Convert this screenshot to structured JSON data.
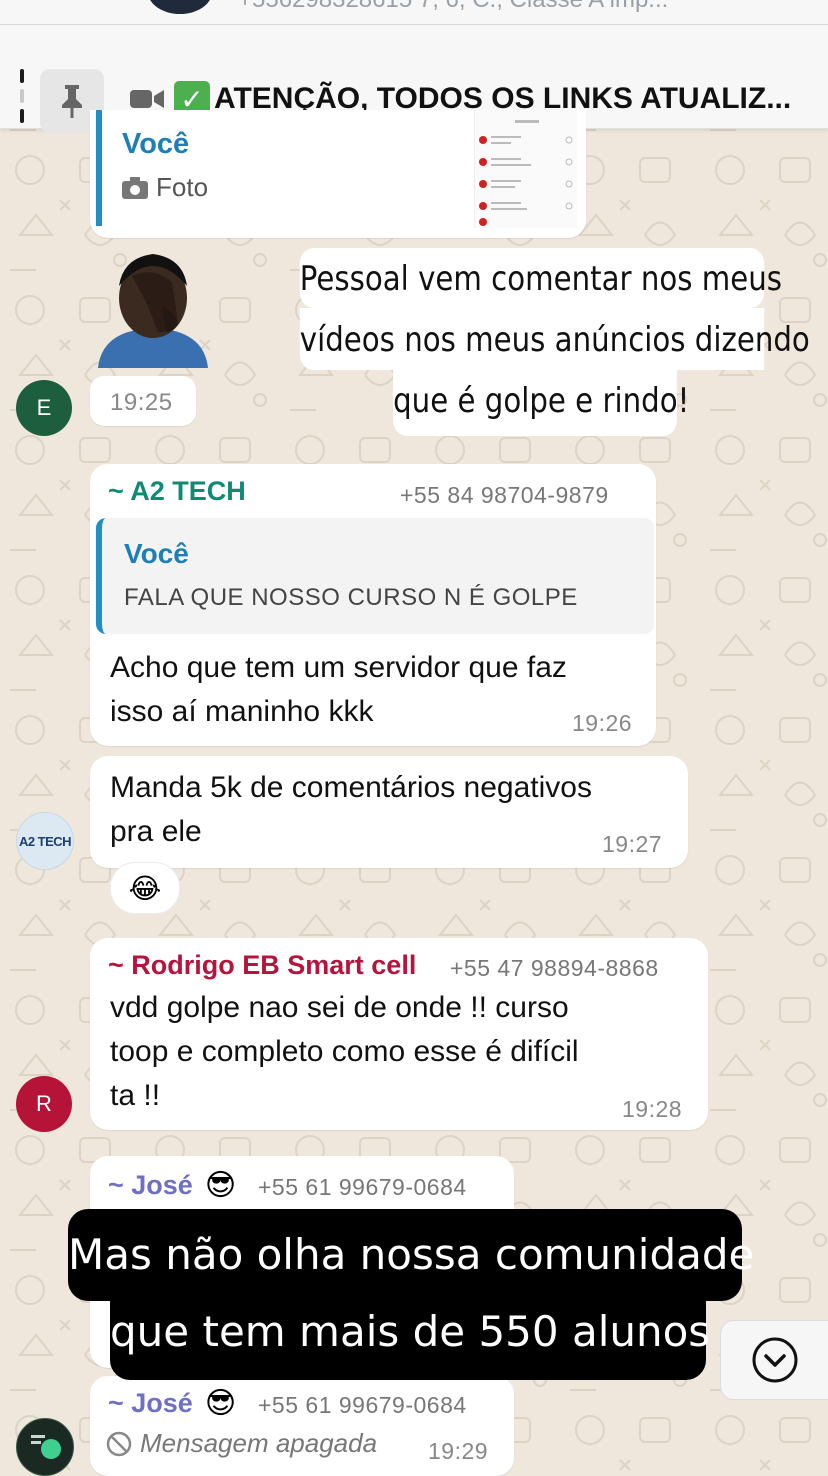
{
  "header": {
    "subtitle": "+556298328615 7, 6, C., Classe A imp..."
  },
  "pinned": {
    "text": "ATENÇÃO, TODOS OS LINKS ATUALIZ...",
    "check_icon": "✅"
  },
  "photo_reply": {
    "author": "Você",
    "label": "Foto"
  },
  "story_overlay_1": {
    "lines": [
      "Pessoal vem comentar nos meus",
      "vídeos nos meus anúncios dizendo",
      "que é golpe e rindo!"
    ]
  },
  "first_time": "19:25",
  "avatars": {
    "e": "E",
    "r": "R",
    "a2tech": "A2 TECH"
  },
  "messages": [
    {
      "sender": "~ A2 TECH",
      "phone": "+55 84 98704-9879",
      "quote_author": "Você",
      "quote_text": "FALA QUE NOSSO CURSO N É GOLPE",
      "text_lines": [
        "Acho que tem um servidor que faz",
        "isso aí maninho kkk"
      ],
      "time": "19:26"
    },
    {
      "text_lines": [
        "Manda 5k de comentários negativos",
        "pra ele"
      ],
      "time": "19:27",
      "reaction": "😂"
    },
    {
      "sender": "~ Rodrigo EB Smart cell",
      "phone": "+55 47 98894-8868",
      "text_lines": [
        "vdd golpe nao sei de onde !! curso",
        "toop e completo como esse é difícil",
        "ta !!"
      ],
      "time": "19:28"
    },
    {
      "sender": "~ José",
      "emoji": "😎",
      "phone": "+55 61 99679-0684"
    },
    {
      "sender": "~ José",
      "emoji": "😎",
      "phone": "+55 61 99679-0684",
      "deleted_text": "Mensagem apagada",
      "time": "19:29"
    }
  ],
  "story_overlay_2": {
    "lines": [
      "Mas não olha nossa comunidade",
      "que tem mais de 550 alunos"
    ]
  },
  "colors": {
    "a2tech_name": "#0f8a73",
    "rodrigo_name": "#b5143c",
    "jose_name": "#6f6fc4",
    "quote_bar": "#1f8fc6",
    "avatar_e": "#1c5e3d",
    "avatar_r": "#b51337"
  }
}
